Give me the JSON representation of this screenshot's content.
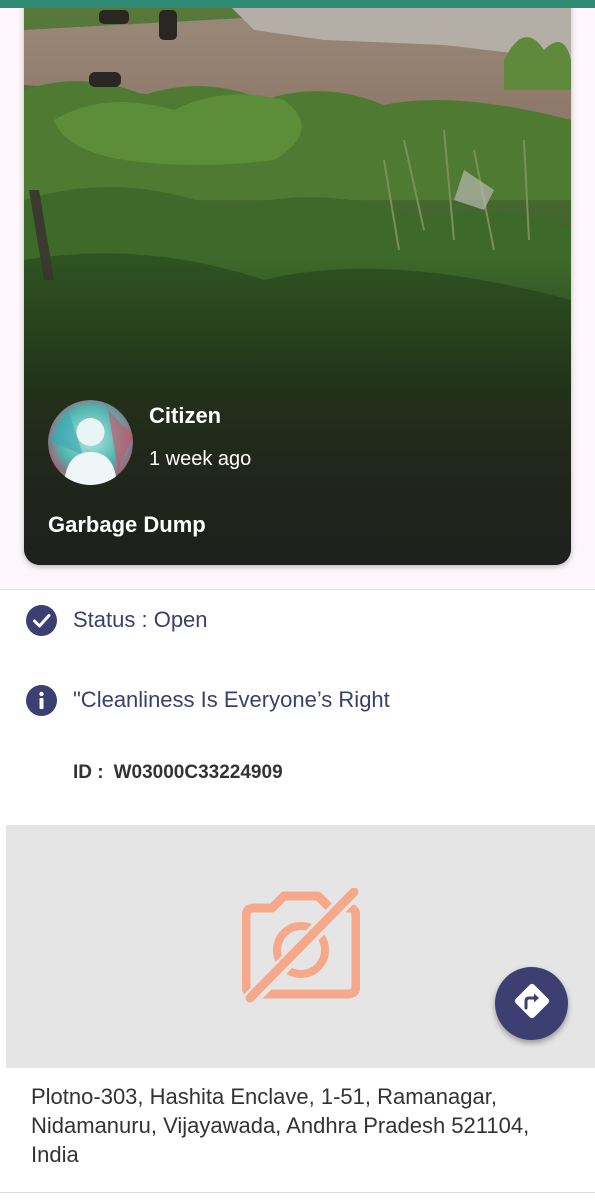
{
  "report": {
    "poster_name": "Citizen",
    "posted_time": "1 week ago",
    "title": "Garbage Dump",
    "status_text": "Status : Open",
    "description": "\"Cleanliness Is Everyone’s Right",
    "id_label": "ID :",
    "id_value": "W03000C33224909",
    "address": "Plotno-303, Hashita Enclave, 1-51, Ramanagar, Nidamanuru, Vijayawada, Andhra Pradesh 521104, India"
  },
  "icons": {
    "status": "check-circle-icon",
    "description": "info-icon",
    "no_image": "no-camera-icon",
    "directions": "directions-icon",
    "avatar": "user-avatar"
  },
  "colors": {
    "accent": "#3d3f73",
    "text_primary": "#3a3f6e",
    "no_image_icon": "#f5a98a",
    "map_placeholder_bg": "#e5e5e5",
    "status_bar": "#2e8a72"
  }
}
